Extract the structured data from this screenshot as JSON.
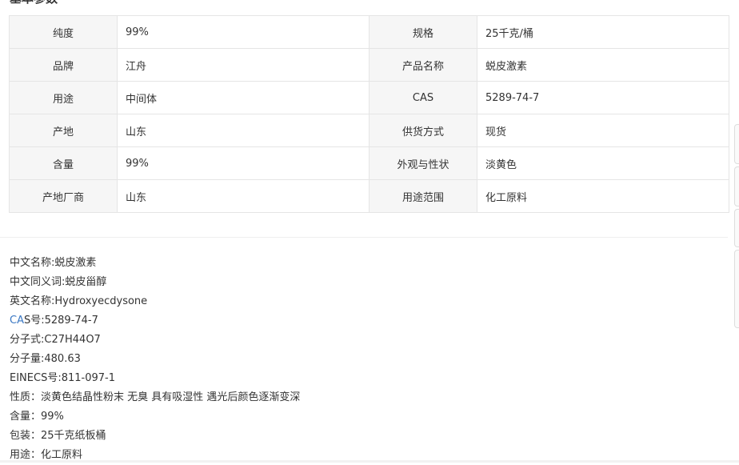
{
  "section": {
    "heading": "基本参数"
  },
  "params": {
    "rows": [
      {
        "k1": "纯度",
        "v1": "99%",
        "k2": "规格",
        "v2": "25千克/桶"
      },
      {
        "k1": "品牌",
        "v1": "江舟",
        "k2": "产品名称",
        "v2": "蜕皮激素"
      },
      {
        "k1": "用途",
        "v1": "中间体",
        "k2": "CAS",
        "v2": "5289-74-7"
      },
      {
        "k1": "产地",
        "v1": "山东",
        "k2": "供货方式",
        "v2": "现货"
      },
      {
        "k1": "含量",
        "v1": "99%",
        "k2": "外观与性状",
        "v2": "淡黄色"
      },
      {
        "k1": "产地厂商",
        "v1": "山东",
        "k2": "用途范围",
        "v2": "化工原料"
      }
    ]
  },
  "details": {
    "cn_name": "中文名称:蜕皮激素",
    "cn_synonym": "中文同义词:蜕皮甾醇",
    "en_name": "英文名称:Hydroxyecdysone",
    "cas_link": "CA",
    "cas_rest": "S号:5289-74-7",
    "formula": "分子式:C27H44O7",
    "mol_weight": "分子量:480.63",
    "einecs": "EINECS号:811-097-1",
    "property": "性质：淡黄色结晶性粉末 无臭 具有吸湿性 遇光后颜色逐渐变深",
    "content": "含量：99%",
    "packing": "包装：25千克纸板桶",
    "usage": "用途：化工原料"
  }
}
